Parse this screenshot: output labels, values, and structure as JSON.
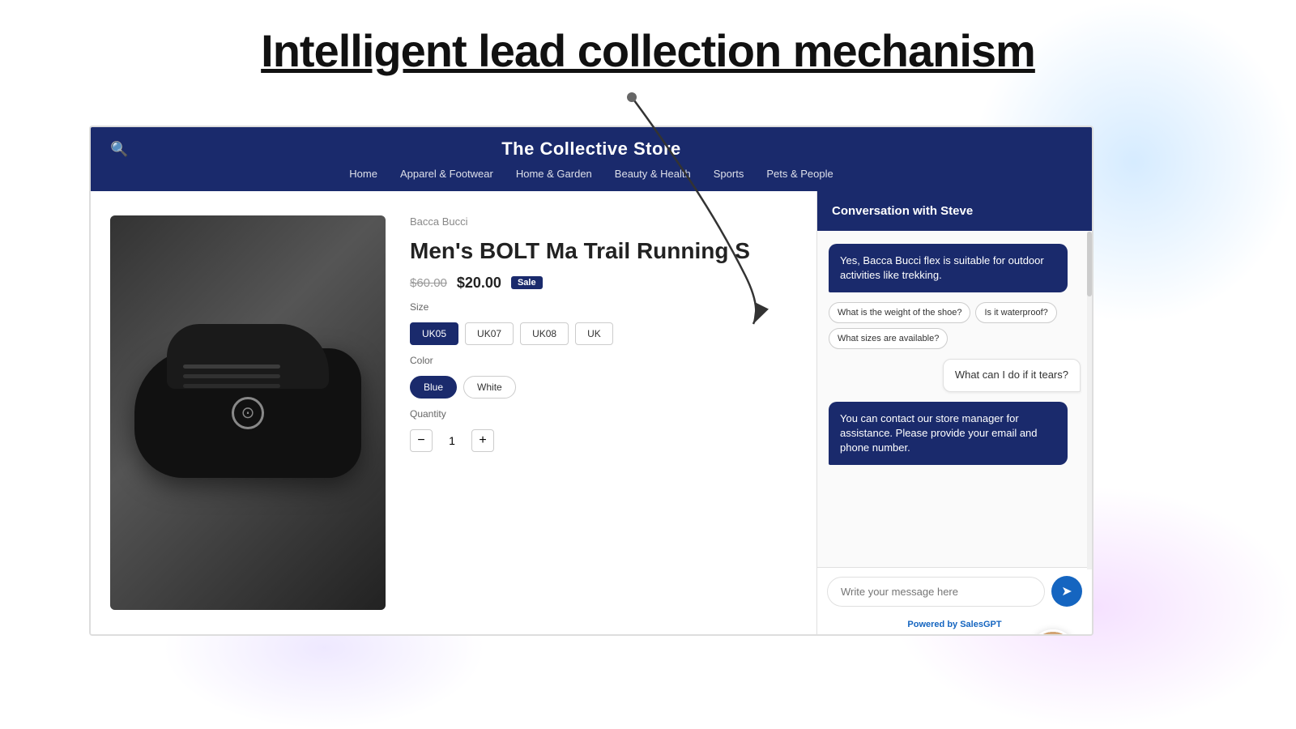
{
  "page": {
    "title": "Intelligent lead collection mechanism"
  },
  "store": {
    "title": "The Collective Store",
    "nav": [
      "Home",
      "Apparel & Footwear",
      "Home & Garden",
      "Beauty & Health",
      "Sports",
      "Pets & People"
    ]
  },
  "product": {
    "brand": "Bacca Bucci",
    "name": "Men's BOLT Ma Trail Running S",
    "price_original": "$60.00",
    "price_sale": "$20.00",
    "sale_label": "Sale",
    "size_label": "Size",
    "sizes": [
      "UK05",
      "UK07",
      "UK08",
      "UK"
    ],
    "color_label": "Color",
    "colors": [
      "Blue",
      "White"
    ],
    "quantity_label": "Quantity",
    "qty": "1"
  },
  "chat": {
    "header_title": "Conversation with Steve",
    "messages": [
      {
        "type": "bot",
        "text": "Yes, Bacca Bucci flex is suitable for outdoor activities like trekking."
      },
      {
        "type": "quick_replies",
        "options": [
          "What is the weight of the shoe?",
          "Is it waterproof?",
          "What sizes are available?"
        ]
      },
      {
        "type": "user",
        "text": "What can I do if it tears?"
      },
      {
        "type": "bot",
        "text": "You can contact our store manager for assistance. Please provide your email and phone number."
      }
    ],
    "input_placeholder": "Write your message here",
    "powered_by_prefix": "Powered by ",
    "powered_by_brand": "SalesGPT"
  }
}
